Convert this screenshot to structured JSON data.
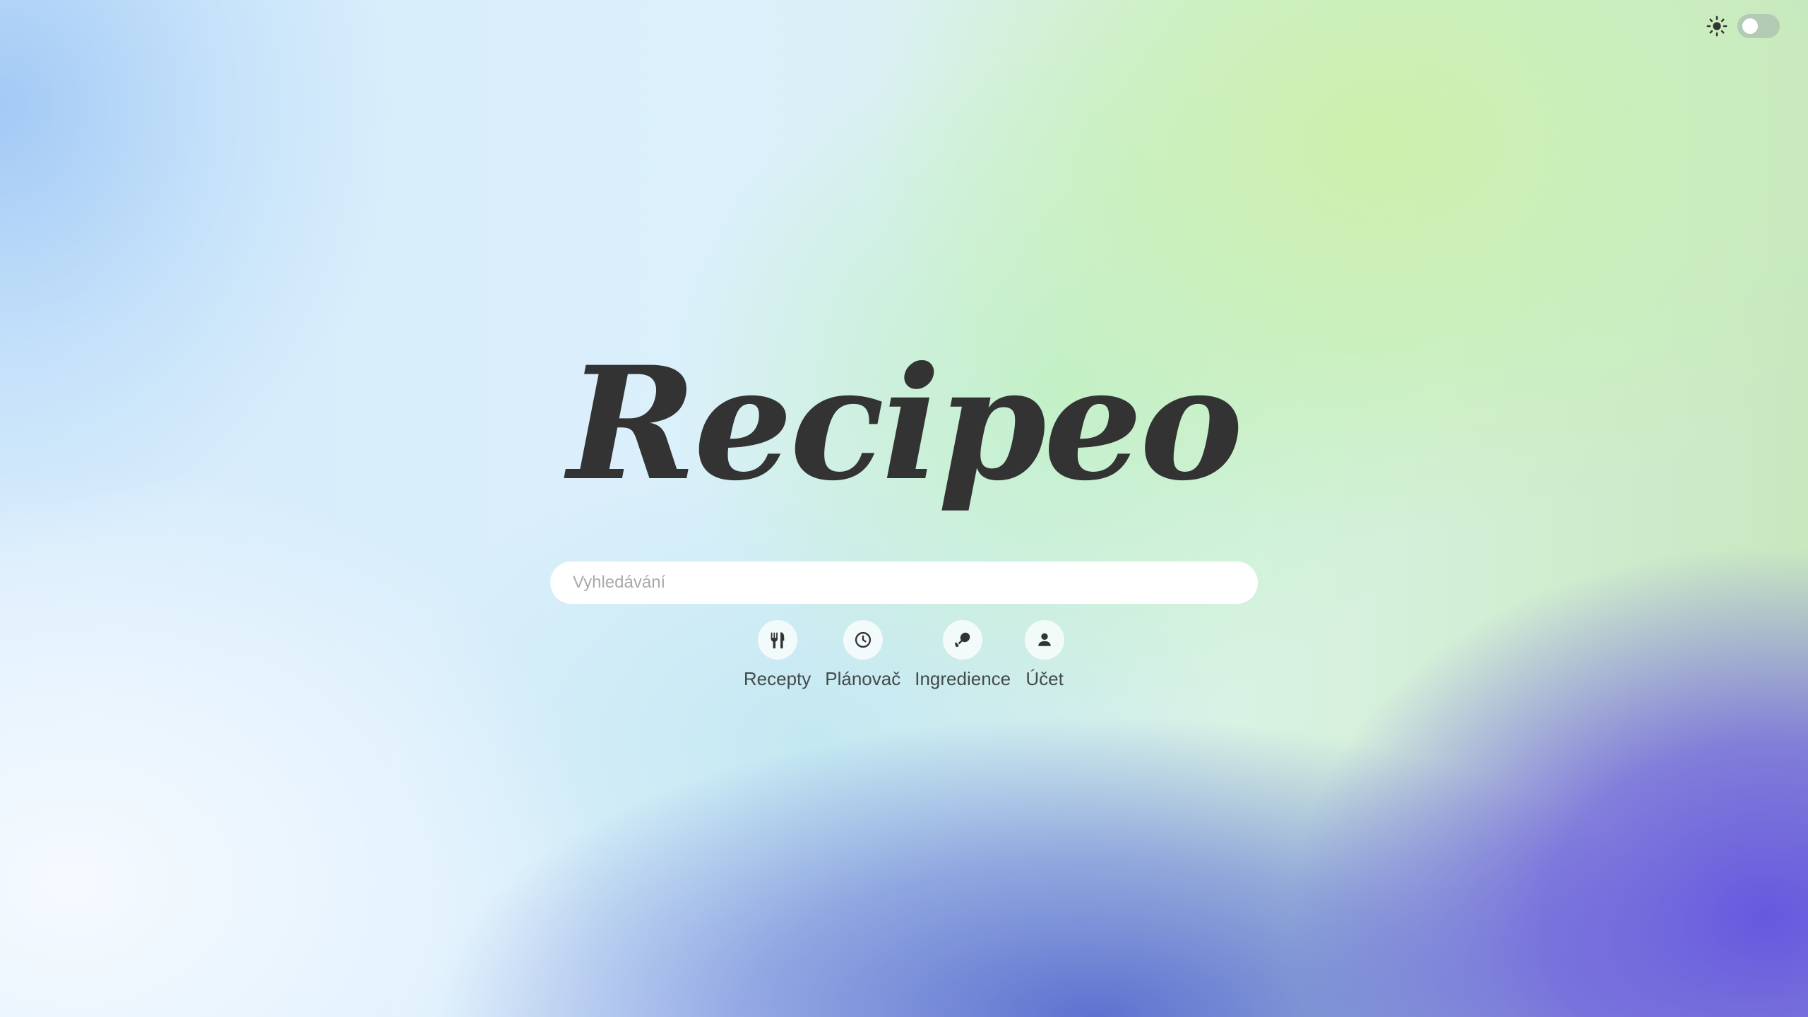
{
  "theme_toggle": {
    "icon": "sun-icon",
    "state": "off"
  },
  "logo": {
    "text": "Recipeo"
  },
  "search": {
    "placeholder": "Vyhledávání",
    "value": ""
  },
  "nav": {
    "items": [
      {
        "label": "Recepty",
        "icon": "fork-knife-icon"
      },
      {
        "label": "Plánovač",
        "icon": "clock-icon"
      },
      {
        "label": "Ingredience",
        "icon": "drumstick-icon"
      },
      {
        "label": "Účet",
        "icon": "user-icon"
      }
    ]
  },
  "colors": {
    "text": "#333333",
    "search_bg": "#ffffff",
    "accent_purple": "#6250e1",
    "accent_green": "#c8f0b4"
  }
}
